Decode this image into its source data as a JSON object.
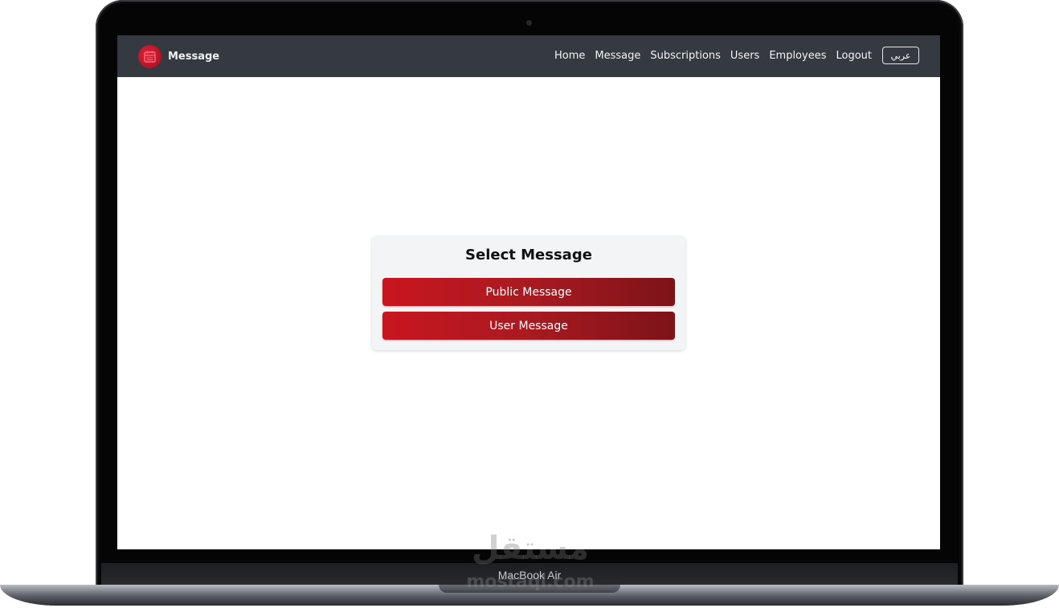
{
  "navbar": {
    "brand": "Message",
    "links": [
      "Home",
      "Message",
      "Subscriptions",
      "Users",
      "Employees",
      "Logout"
    ],
    "language_button": "عربي"
  },
  "card": {
    "title": "Select Message",
    "buttons": [
      "Public Message",
      "User Message"
    ]
  },
  "device": {
    "label": "MacBook Air"
  },
  "watermark": {
    "arabic": "مستقل",
    "latin": "mostaql.com"
  },
  "colors": {
    "navbar_bg": "#343a40",
    "button_start": "#c8161f",
    "button_end": "#7d1318",
    "card_bg": "#f3f4f6"
  }
}
